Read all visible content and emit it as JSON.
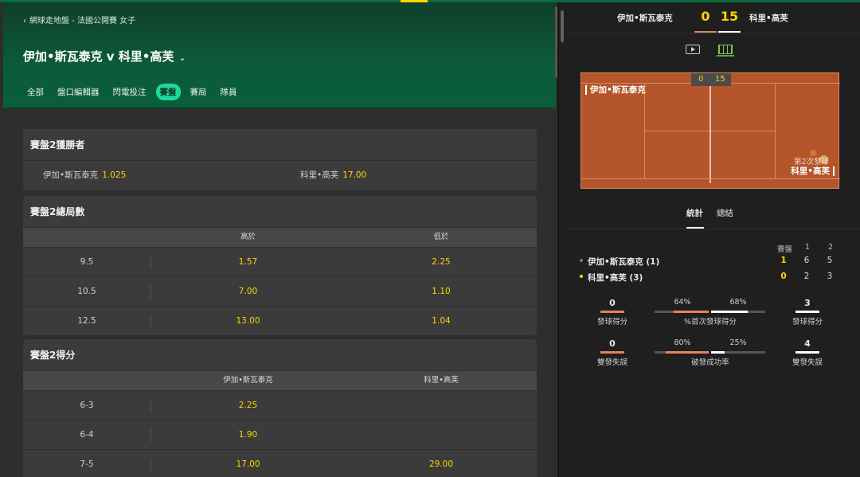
{
  "breadcrumb": "網球走地盤 - 法國公開賽 女子",
  "match": {
    "title": "伊加•斯瓦泰克 v 科里•高芙"
  },
  "tabs": [
    {
      "label": "全部"
    },
    {
      "label": "盤口編輯器"
    },
    {
      "label": "閃電投注"
    },
    {
      "label": "賽盤",
      "active": true
    },
    {
      "label": "賽局"
    },
    {
      "label": "隊員"
    }
  ],
  "markets": {
    "winner": {
      "title": "賽盤2獲勝者",
      "p1": {
        "name": "伊加•斯瓦泰克",
        "odds": "1.025"
      },
      "p2": {
        "name": "科里•高芙",
        "odds": "17.00"
      }
    },
    "total_games": {
      "title": "賽盤2總局數",
      "col1": "高於",
      "col2": "低於",
      "rows": [
        {
          "line": "9.5",
          "over": "1.57",
          "under": "2.25"
        },
        {
          "line": "10.5",
          "over": "7.00",
          "under": "1.10"
        },
        {
          "line": "12.5",
          "over": "13.00",
          "under": "1.04"
        }
      ]
    },
    "set_score": {
      "title": "賽盤2得分",
      "col1": "伊加•斯瓦泰克",
      "col2": "科里•高芙",
      "rows": [
        {
          "score": "6-3",
          "p1": "2.25",
          "p2": ""
        },
        {
          "score": "6-4",
          "p1": "1.90",
          "p2": ""
        },
        {
          "score": "7-5",
          "p1": "17.00",
          "p2": "29.00"
        }
      ]
    }
  },
  "scoreboard": {
    "p1": "伊加•斯瓦泰克",
    "p2": "科里•高芙",
    "p1_points": "0",
    "p2_points": "15"
  },
  "court": {
    "p1": "伊加•斯瓦泰克",
    "p2": "科里•高芙",
    "score_p1": "0",
    "score_p2": "15",
    "serve_note": "第2次發球"
  },
  "stats": {
    "tabs": [
      {
        "label": "統計",
        "active": true
      },
      {
        "label": "總結"
      }
    ],
    "header": {
      "current": "賽盤",
      "s1": "1",
      "s2": "2"
    },
    "players": [
      {
        "name": "伊加•斯瓦泰克 (1)",
        "current": "1",
        "s1": "6",
        "s2": "5",
        "dot": "#777777"
      },
      {
        "name": "科里•高芙 (3)",
        "current": "0",
        "s1": "2",
        "s2": "3",
        "dot": "#ffd400"
      }
    ],
    "row1": {
      "left_val": "0",
      "left_label": "發球得分",
      "mid_left": "64%",
      "mid_right": "68%",
      "mid_label": "%首次發球得分",
      "mid_left_frac": 0.64,
      "mid_right_frac": 0.68,
      "right_val": "3",
      "right_label": "發球得分"
    },
    "row2": {
      "left_val": "0",
      "left_label": "雙發失誤",
      "mid_left": "80%",
      "mid_right": "25%",
      "mid_label": "破發成功率",
      "mid_left_frac": 0.8,
      "mid_right_frac": 0.25,
      "right_val": "4",
      "right_label": "雙發失誤"
    },
    "colors": {
      "p1": "#e8825f",
      "p2": "#ffffff",
      "track": "#555555"
    }
  }
}
